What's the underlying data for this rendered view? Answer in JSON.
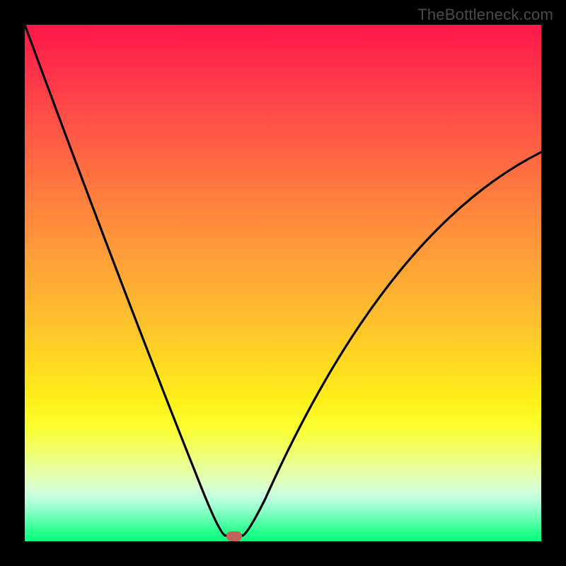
{
  "watermark": "TheBottleneck.com",
  "chart_data": {
    "type": "line",
    "title": "",
    "xlabel": "",
    "ylabel": "",
    "xlim": [
      0,
      100
    ],
    "ylim": [
      0,
      100
    ],
    "x": [
      0,
      5,
      10,
      15,
      20,
      25,
      30,
      33,
      36,
      38,
      39,
      40,
      41,
      42,
      45,
      50,
      55,
      60,
      65,
      70,
      75,
      80,
      85,
      90,
      95,
      100
    ],
    "values": [
      100,
      88,
      76,
      64,
      53,
      42,
      30,
      20,
      11,
      4,
      1,
      0,
      0,
      0,
      7,
      18,
      28,
      36,
      43,
      49,
      55,
      60,
      64,
      68,
      72,
      75
    ],
    "marker": {
      "x": 40.5,
      "y": 0
    },
    "background_gradient_top_color": "#ff1749",
    "background_gradient_bottom_color": "#05ff7c",
    "curve_color": "#000000",
    "marker_color": "#c06358"
  },
  "marker_style": {
    "left_pct": 40.5,
    "top_pct": 99.0
  }
}
